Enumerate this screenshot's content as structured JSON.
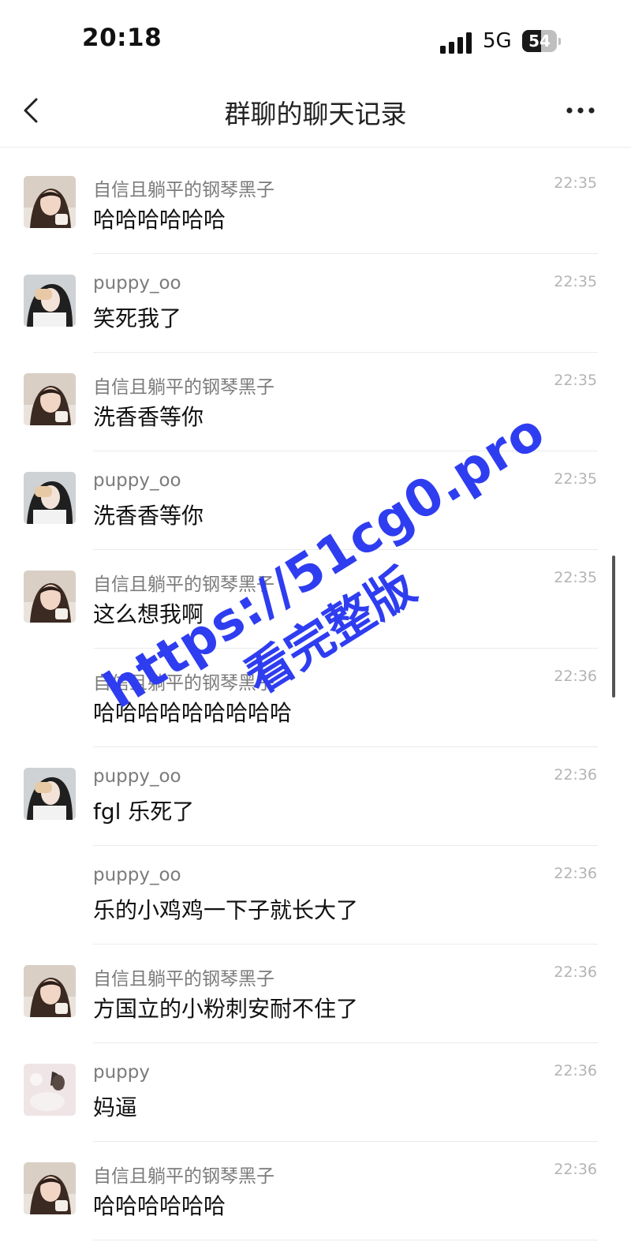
{
  "status_bar": {
    "time": "20:18",
    "network": "5G",
    "battery": "54",
    "battery_level": 0.54
  },
  "nav": {
    "title": "群聊的聊天记录",
    "back_icon": "chevron-left-icon",
    "more_icon": "ellipsis-icon"
  },
  "messages": [
    {
      "sender": "自信且躺平的钢琴黑子",
      "text": "哈哈哈哈哈哈",
      "time": "22:35",
      "avatar": "a"
    },
    {
      "sender": "puppy_oo",
      "text": "笑死我了",
      "time": "22:35",
      "avatar": "b"
    },
    {
      "sender": "自信且躺平的钢琴黑子",
      "text": "洗香香等你",
      "time": "22:35",
      "avatar": "a"
    },
    {
      "sender": "puppy_oo",
      "text": "洗香香等你",
      "time": "22:35",
      "avatar": "b"
    },
    {
      "sender": "自信且躺平的钢琴黑子",
      "text": "这么想我啊",
      "time": "22:35",
      "avatar": "a"
    },
    {
      "sender": "自信且躺平的钢琴黑子",
      "text": "哈哈哈哈哈哈哈哈哈",
      "time": "22:36",
      "avatar": ""
    },
    {
      "sender": "puppy_oo",
      "text": "fgl 乐死了",
      "time": "22:36",
      "avatar": "b"
    },
    {
      "sender": "puppy_oo",
      "text": "乐的小鸡鸡一下子就长大了",
      "time": "22:36",
      "avatar": ""
    },
    {
      "sender": "自信且躺平的钢琴黑子",
      "text": "方国立的小粉刺安耐不住了",
      "time": "22:36",
      "avatar": "a"
    },
    {
      "sender": "puppy",
      "text": "妈逼",
      "time": "22:36",
      "avatar": "c"
    },
    {
      "sender": "自信且躺平的钢琴黑子",
      "text": "哈哈哈哈哈哈",
      "time": "22:36",
      "avatar": "a"
    }
  ],
  "watermark": {
    "line1": "https://51cg0.pro",
    "line2": "看完整版"
  }
}
